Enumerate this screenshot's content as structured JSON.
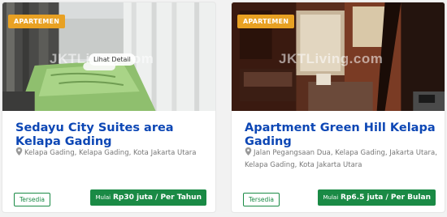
{
  "listings": [
    {
      "category_badge": "APARTEMEN",
      "watermark": "JKTLiving.com",
      "hover_detail": "Lihat Detail",
      "title": "Sedayu City Suites area Kelapa Gading",
      "location": "Kelapa Gading, Kelapa Gading, Kota Jakarta Utara",
      "status": "Tersedia",
      "price_prefix": "Mulai",
      "price": "Rp30 juta / Per Tahun"
    },
    {
      "category_badge": "APARTEMEN",
      "watermark": "JKTLiving.com",
      "title": "Apartment Green Hill Kelapa Gading",
      "location": "Jalan Pegangsaan Dua, Kelapa Gading, Jakarta Utara, Kelapa Gading, Kota Jakarta Utara",
      "status": "Tersedia",
      "price_prefix": "Mulai",
      "price": "Rp6.5 juta / Per Bulan"
    }
  ],
  "colors": {
    "badge": "#e8a123",
    "title": "#0d47b5",
    "status": "#1a8a45",
    "price_button": "#1a8a45"
  },
  "icons": [
    "map-pin-icon"
  ]
}
